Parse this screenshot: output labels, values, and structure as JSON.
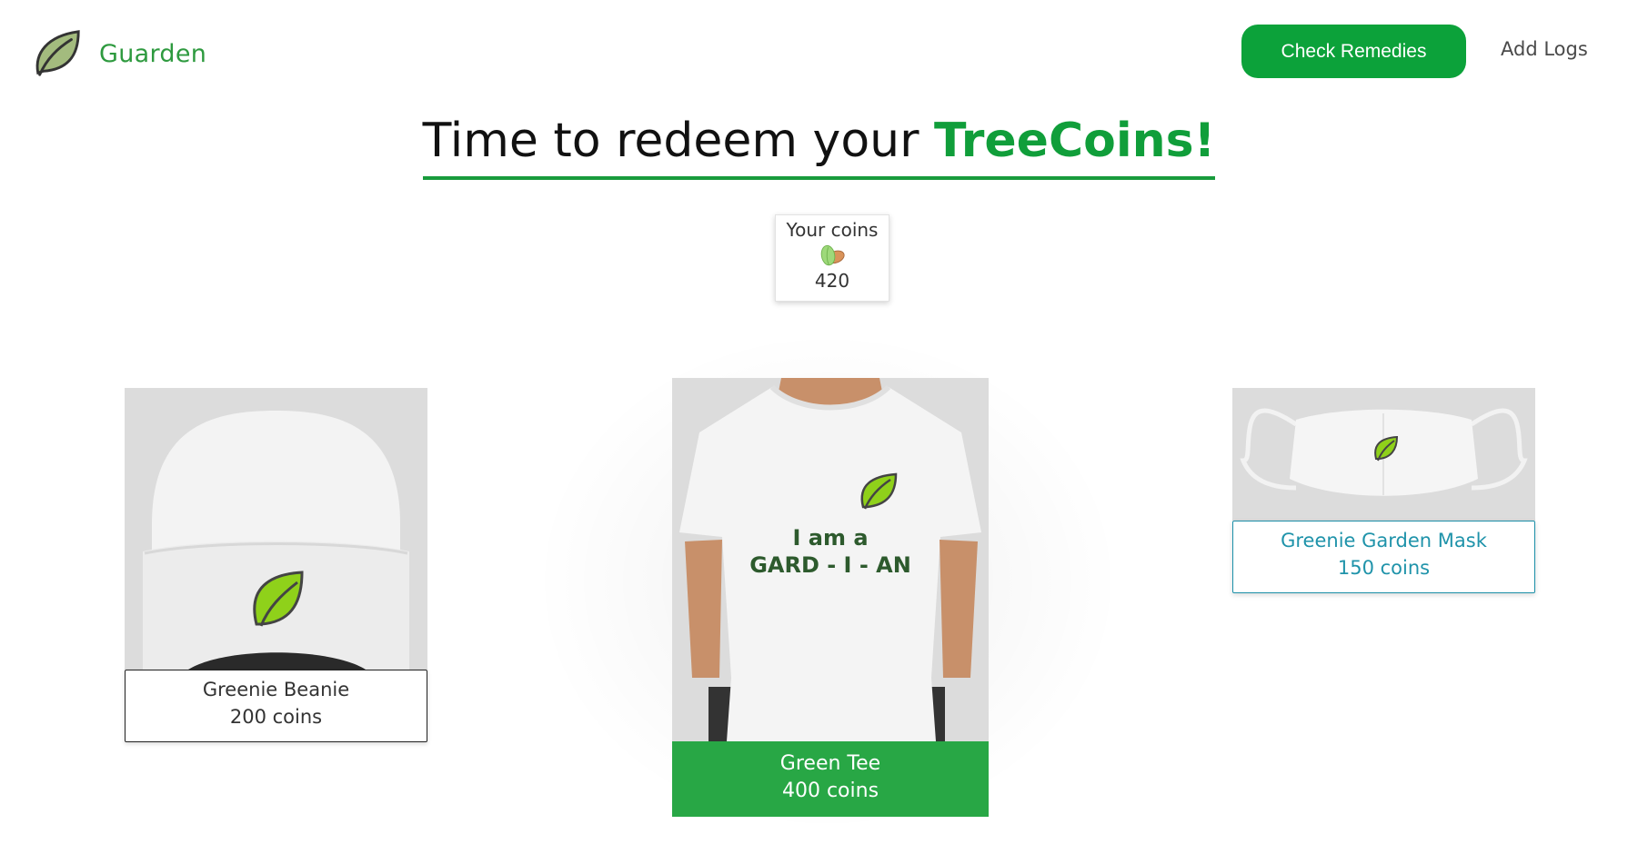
{
  "header": {
    "brand_name": "Guarden",
    "nav": {
      "primary_button": "Check Remedies",
      "secondary_link": "Add Logs"
    }
  },
  "title": {
    "prefix": "Time to redeem your ",
    "highlight": "TreeCoins!"
  },
  "coins": {
    "label": "Your coins",
    "value": "420",
    "icon": "coin-seeds-icon"
  },
  "products": [
    {
      "name": "Greenie Beanie",
      "price": "200 coins",
      "image": "beanie-image"
    },
    {
      "name": "Green Tee",
      "price": "400 coins",
      "image": "tshirt-image",
      "shirt_text": [
        "I am a",
        "GARD - I - AN"
      ]
    },
    {
      "name": "Greenie Garden Mask",
      "price": "150 coins",
      "image": "mask-image"
    }
  ],
  "colors": {
    "brand_green": "#0ca23a",
    "title_green": "#109e3a",
    "tee_caption": "#28a745",
    "mask_caption": "#1f93aa"
  }
}
